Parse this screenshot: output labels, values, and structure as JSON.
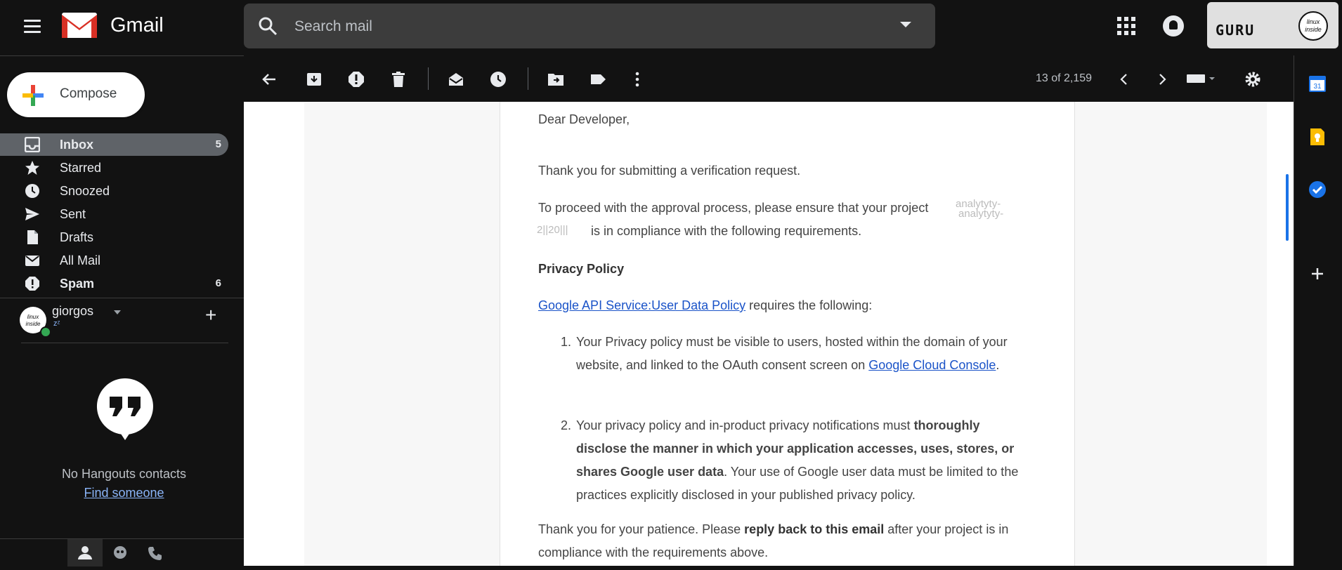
{
  "app": {
    "name": "Gmail"
  },
  "search": {
    "placeholder": "Search mail"
  },
  "account": {
    "badge_text": "GURU",
    "logo_text": "linux inside"
  },
  "compose": {
    "label": "Compose"
  },
  "nav": [
    {
      "label": "Inbox",
      "count": "5",
      "active": true,
      "bold": true
    },
    {
      "label": "Starred",
      "count": ""
    },
    {
      "label": "Snoozed",
      "count": ""
    },
    {
      "label": "Sent",
      "count": ""
    },
    {
      "label": "Drafts",
      "count": ""
    },
    {
      "label": "All Mail",
      "count": ""
    },
    {
      "label": "Spam",
      "count": "6",
      "bold": true
    }
  ],
  "hangouts": {
    "user_name": "giorgos",
    "status": "zᶻ",
    "avatar_text": "linux inside",
    "empty_text": "No Hangouts contacts",
    "find_link": "Find someone"
  },
  "toolbar": {
    "page_count": "13 of 2,159"
  },
  "email": {
    "greeting": "Dear Developer,",
    "thanks": "Thank you for submitting a verification request.",
    "proceed_before": "To proceed with the approval process, please ensure that your project ",
    "project_name_faint": "analytyty-",
    "project_id_faint": "2||20|||",
    "proceed_after": " is in compliance with the following requirements.",
    "section_title": "Privacy Policy",
    "policy_link": "Google API Service:User Data Policy",
    "policy_after": " requires the following:",
    "item1_text": "Your Privacy policy must be visible to users, hosted within the domain of your website, and linked to the OAuth consent screen on ",
    "item1_link": "Google Cloud Console",
    "item1_end": ".",
    "item2_before": "Your privacy policy and in-product privacy notifications must ",
    "item2_bold": "thoroughly disclose the manner in which your application accesses, uses, stores, or shares Google user data",
    "item2_after": ". Your use of Google user data must be limited to the practices explicitly disclosed in your published privacy policy.",
    "closing_before": "Thank you for your patience. Please ",
    "closing_bold": "reply back to this email",
    "closing_after": " after your project is in compliance with the requirements above."
  },
  "side_panel": {
    "calendar_day": "31"
  },
  "colors": {
    "accent": "#1a73e8",
    "link": "#1a53c8",
    "dark_bg": "#121212"
  }
}
